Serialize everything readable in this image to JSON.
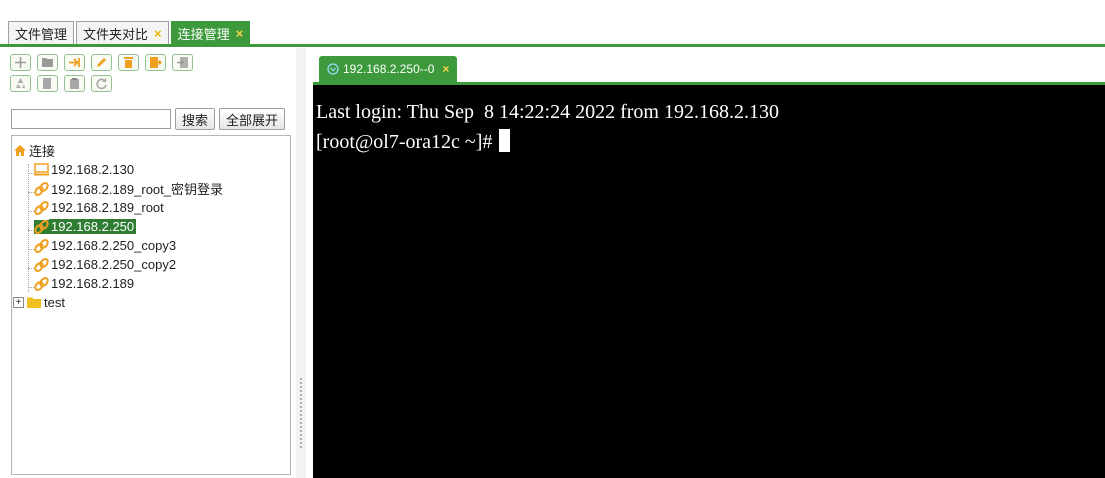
{
  "top_tabs": [
    {
      "label": "文件管理",
      "closable": false,
      "active": false
    },
    {
      "label": "文件夹对比",
      "closable": true,
      "active": false
    },
    {
      "label": "连接管理",
      "closable": true,
      "active": true
    }
  ],
  "close_glyph": "×",
  "toolbar": {
    "row1": [
      "add-icon",
      "folder-icon",
      "connect-icon",
      "edit-icon",
      "delete-icon",
      "export-icon",
      "import-icon"
    ],
    "row2": [
      "recycle-icon",
      "copy-icon",
      "paste-icon",
      "refresh-icon"
    ]
  },
  "search": {
    "placeholder": "",
    "value": "",
    "search_label": "搜索",
    "expand_label": "全部展开"
  },
  "tree": {
    "root_label": "连接",
    "items": [
      {
        "label": "192.168.2.130",
        "icon": "computer-icon"
      },
      {
        "label": "192.168.2.189_root_密钥登录",
        "icon": "link-icon"
      },
      {
        "label": "192.168.2.189_root",
        "icon": "link-icon"
      },
      {
        "label": "192.168.2.250",
        "icon": "link-icon",
        "selected": true
      },
      {
        "label": "192.168.2.250_copy3",
        "icon": "link-icon"
      },
      {
        "label": "192.168.2.250_copy2",
        "icon": "link-icon"
      },
      {
        "label": "192.168.2.189",
        "icon": "link-icon"
      }
    ],
    "folder": {
      "label": "test",
      "expander": "⊞"
    }
  },
  "session_tab": {
    "label": "192.168.2.250--0",
    "active": true
  },
  "terminal": {
    "lines": [
      "Last login: Thu Sep  8 14:22:24 2022 from 192.168.2.130",
      "[root@ol7-ora12c ~]# "
    ]
  },
  "colors": {
    "accent": "#3c9a3c",
    "selected": "#2f7d32",
    "close": "#f5b400",
    "icon_orange": "#f0a020",
    "terminal_bg": "#000000"
  }
}
